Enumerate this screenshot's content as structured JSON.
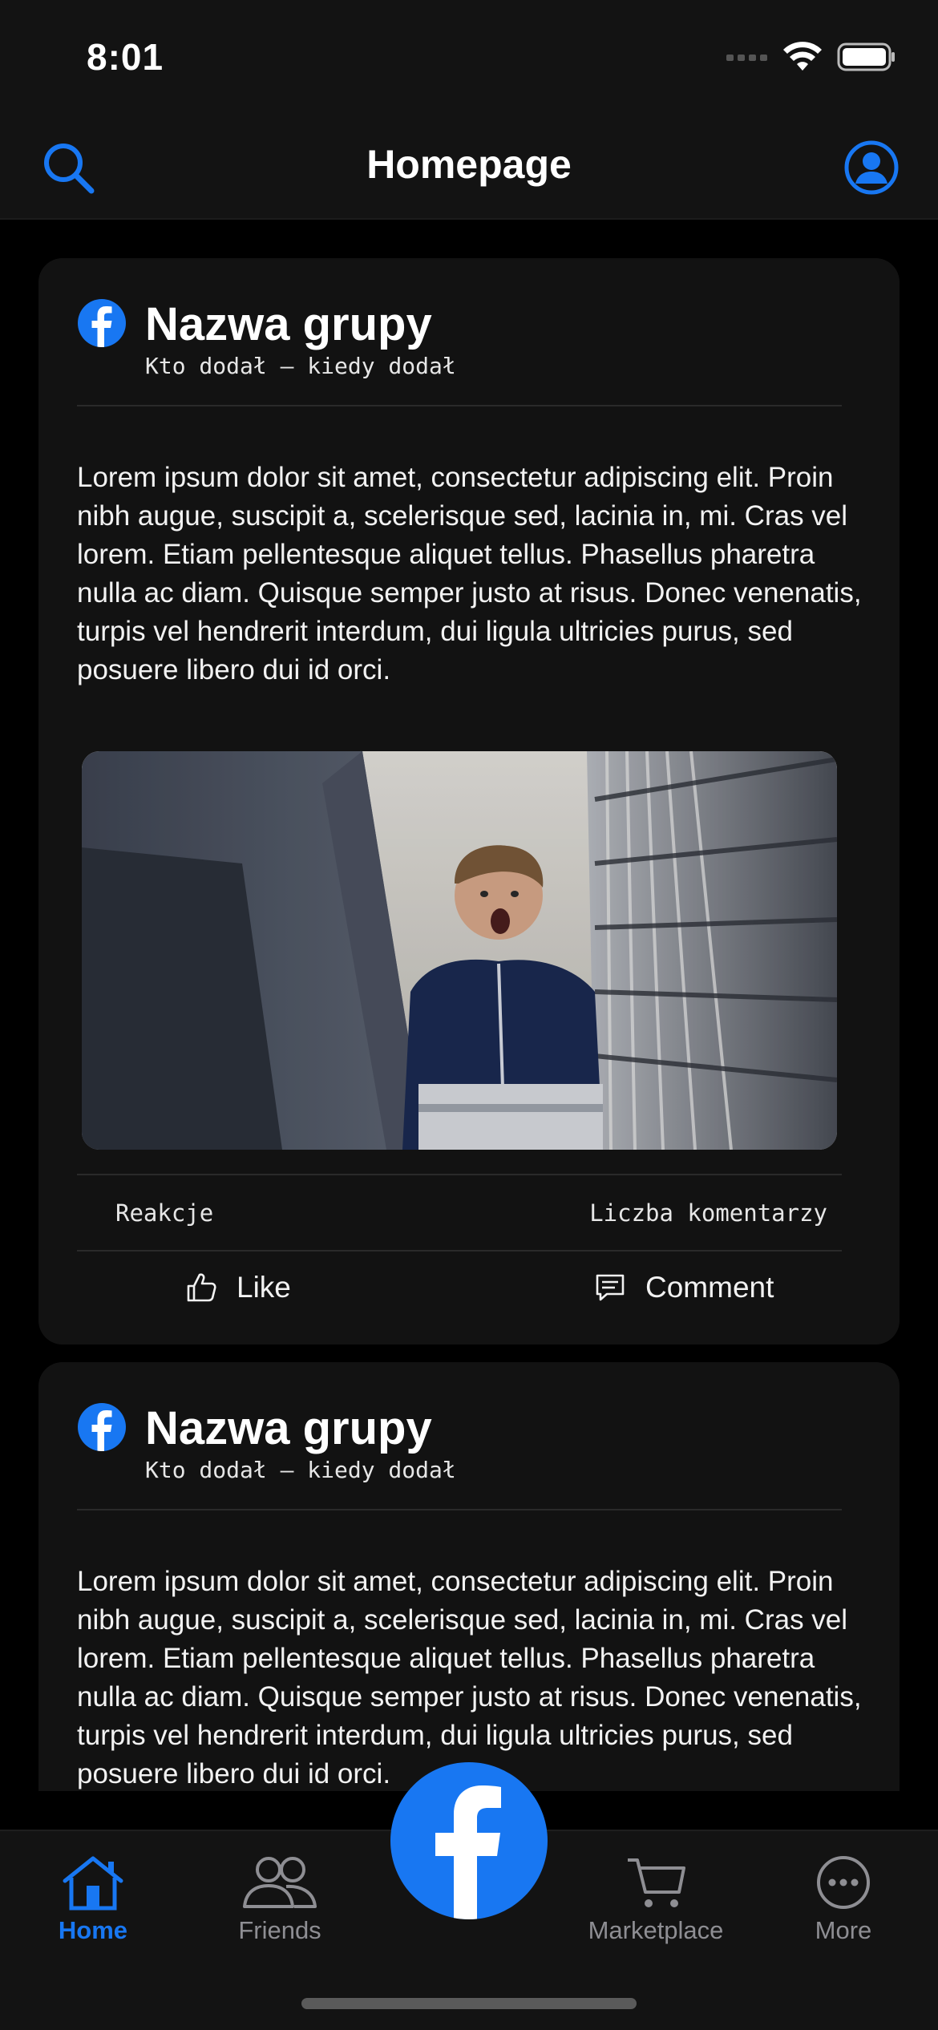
{
  "status_bar": {
    "time": "8:01"
  },
  "nav": {
    "title": "Homepage",
    "search_icon": "search-icon",
    "profile_icon": "profile-icon"
  },
  "colors": {
    "accent": "#1877f2",
    "background": "#000000",
    "card": "#121212",
    "bar": "#131313",
    "inactive": "#8e8e93"
  },
  "posts": [
    {
      "group_name": "Nazwa grupy",
      "meta": "Kto dodał – kiedy dodał",
      "body": "Lorem ipsum dolor sit amet, consectetur adipiscing elit. Proin nibh augue, suscipit a, scelerisque sed, lacinia in, mi. Cras vel lorem. Etiam pellentesque aliquet tellus. Phasellus pharetra nulla ac diam. Quisque semper justo at risus. Donec venenatis, turpis vel hendrerit interdum, dui ligula ultricies purus, sed posuere libero dui id orci.",
      "reactions_label": "Reakcje",
      "comments_label": "Liczba komentarzy",
      "like_label": "Like",
      "comment_label": "Comment"
    },
    {
      "group_name": "Nazwa grupy",
      "meta": "Kto dodał – kiedy dodał",
      "body": "Lorem ipsum dolor sit amet, consectetur adipiscing elit. Proin nibh augue, suscipit a, scelerisque sed, lacinia in, mi. Cras vel lorem. Etiam pellentesque aliquet tellus. Phasellus pharetra nulla ac diam. Quisque semper justo at risus. Donec venenatis, turpis vel hendrerit interdum, dui ligula ultricies purus, sed posuere libero dui id orci."
    }
  ],
  "tabs": [
    {
      "label": "Home",
      "icon": "home-icon",
      "active": true
    },
    {
      "label": "Friends",
      "icon": "friends-icon",
      "active": false
    },
    {
      "label": "",
      "icon": "facebook-logo-icon",
      "active": false
    },
    {
      "label": "Marketplace",
      "icon": "cart-icon",
      "active": false
    },
    {
      "label": "More",
      "icon": "more-icon",
      "active": false
    }
  ]
}
